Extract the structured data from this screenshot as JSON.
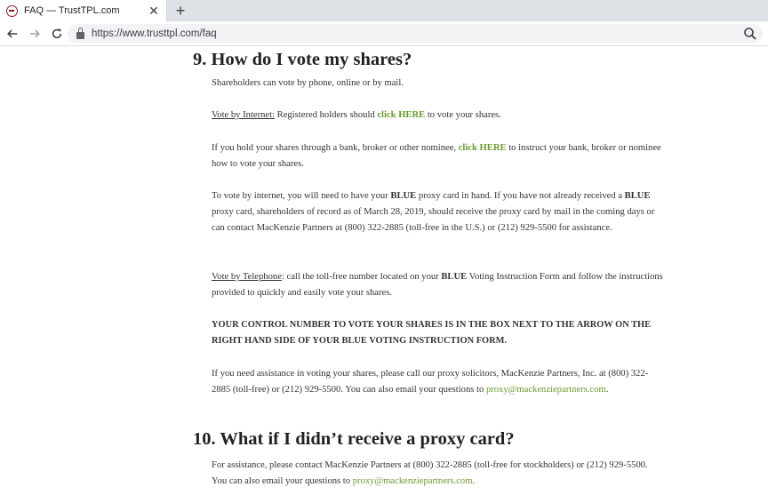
{
  "tab": {
    "title": "FAQ — TrustTPL.com",
    "close": "✕",
    "new_tab": "+"
  },
  "toolbar": {
    "url": "https://www.trusttpl.com/faq"
  },
  "faq9": {
    "heading": "9. How do I vote my shares?",
    "p1": "Shareholders can vote by phone, online or by mail.",
    "p2": {
      "label": "Vote by Internet:",
      "text_a": " Registered holders should ",
      "link": "click HERE",
      "text_b": " to vote your shares."
    },
    "p3": {
      "text_a": "If you hold your shares through a bank, broker or other nominee, ",
      "link": "click HERE",
      "text_b": " to instruct your bank, broker or nominee how to vote your shares."
    },
    "p4": {
      "text_a": "To vote by internet, you will need to have your ",
      "bold_a": "BLUE",
      "text_b": " proxy card in hand. If you have not already received a ",
      "bold_b": "BLUE",
      "text_c": " proxy card, shareholders of record as of March 28, 2019, should receive the proxy card by mail in the coming days or can contact MacKenzie Partners at (800) 322-2885 (toll-free in the U.S.) or (212) 929-5500 for assistance."
    },
    "p5": {
      "label": "Vote by Telephone",
      "text_a": ": call the toll-free number located on your ",
      "bold": "BLUE",
      "text_b": " Voting Instruction Form and follow the instructions provided to quickly and easily vote your shares."
    },
    "p6": "YOUR CONTROL NUMBER TO VOTE YOUR SHARES IS IN THE BOX NEXT TO THE ARROW ON THE RIGHT HAND SIDE OF YOUR BLUE VOTING INSTRUCTION FORM.",
    "p7": {
      "text": "If you need assistance in voting your shares, please call our proxy solicitors, MacKenzie Partners, Inc. at (800) 322-2885 (toll-free) or (212) 929-5500. You can also email your questions to ",
      "email": "proxy@mackenziepartners.com",
      "end": "."
    }
  },
  "faq10": {
    "heading": "10. What if I didn’t receive a proxy card?",
    "p1": {
      "text": "For assistance, please contact MacKenzie Partners at (800) 322-2885 (toll-free for stockholders) or (212) 929-5500. You can also email your questions to ",
      "email": "proxy@mackenziepartners.com",
      "end": "."
    }
  },
  "colors": {
    "link": "#6a9a2e",
    "text": "#333333",
    "heading": "#222222"
  },
  "icons": [
    "favicon-icon",
    "close-icon",
    "plus-icon",
    "back-arrow-icon",
    "forward-arrow-icon",
    "reload-icon",
    "lock-icon",
    "search-icon"
  ]
}
